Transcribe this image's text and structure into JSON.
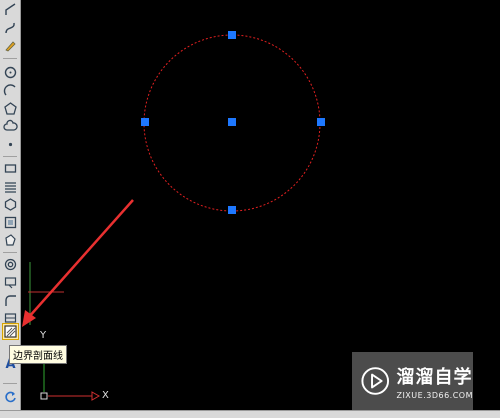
{
  "toolbar": {
    "tooltip": "边界剖面线",
    "tools": [
      {
        "name": "polyline-tool",
        "icon": "polyline-icon"
      },
      {
        "name": "spline-tool",
        "icon": "spline-icon"
      },
      {
        "name": "freehand-tool",
        "icon": "pencil-icon"
      },
      {
        "name": "circle-tool",
        "icon": "circle-icon"
      },
      {
        "name": "arc-tool",
        "icon": "arc-icon"
      },
      {
        "name": "polygon-tool",
        "icon": "polygon-icon"
      },
      {
        "name": "revision-cloud-tool",
        "icon": "cloud-icon"
      },
      {
        "name": "point-tool",
        "icon": "point-icon"
      },
      {
        "name": "rectangle-tool",
        "icon": "rectangle-icon"
      },
      {
        "name": "multiline-tool",
        "icon": "multiline-icon"
      },
      {
        "name": "hexagon-tool",
        "icon": "hexagon-icon"
      },
      {
        "name": "region-tool",
        "icon": "region-icon"
      },
      {
        "name": "wipeout-tool",
        "icon": "wipeout-icon"
      },
      {
        "name": "donut-tool",
        "icon": "donut-icon"
      },
      {
        "name": "ellipse-tool",
        "icon": "ellipse-icon"
      },
      {
        "name": "table-tool",
        "icon": "table-icon"
      },
      {
        "name": "fillet-tool",
        "icon": "fillet-icon"
      },
      {
        "name": "block-tool",
        "icon": "block-icon"
      },
      {
        "name": "boundary-hatch-tool",
        "icon": "hatch-icon"
      },
      {
        "name": "text-tool",
        "icon": "text-icon"
      },
      {
        "name": "refresh-tool",
        "icon": "refresh-icon"
      }
    ],
    "text_tool_glyph": "A"
  },
  "canvas": {
    "axis_y_label": "Y",
    "axis_x_label": "X",
    "circle_color": "#e02020",
    "grip_color": "#1e78ff",
    "arrow_color": "#e83030"
  },
  "watermark": {
    "title": "溜溜自学",
    "url": "ZIXUE.3D66.COM"
  }
}
